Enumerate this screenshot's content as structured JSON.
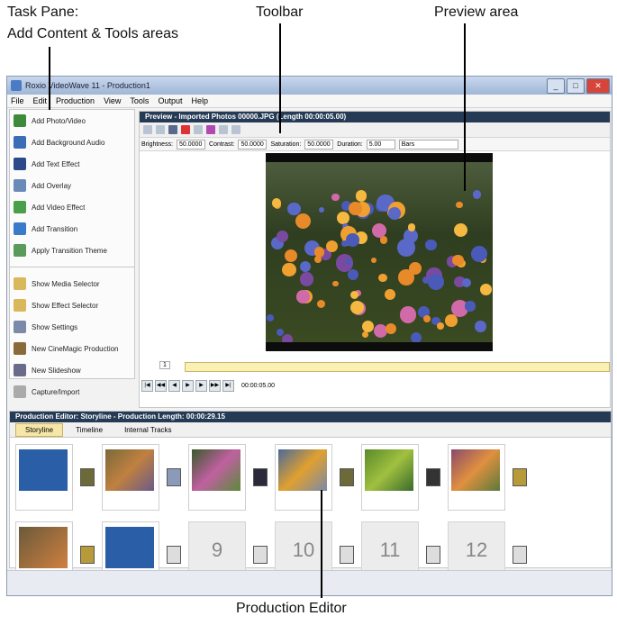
{
  "annotations": {
    "task_pane": "Task Pane:",
    "task_pane_sub": "Add Content & Tools areas",
    "toolbar": "Toolbar",
    "preview_area": "Preview area",
    "production_editor": "Production Editor"
  },
  "window": {
    "title": "Roxio VideoWave 11 - Production1",
    "menu": [
      "File",
      "Edit",
      "Production",
      "View",
      "Tools",
      "Output",
      "Help"
    ]
  },
  "task_pane": {
    "add_items": [
      {
        "label": "Add Photo/Video",
        "icon": "photo-video-icon",
        "color": "#3f8a3a"
      },
      {
        "label": "Add Background Audio",
        "icon": "audio-icon",
        "color": "#3a6fb8"
      },
      {
        "label": "Add Text Effect",
        "icon": "text-effect-icon",
        "color": "#2a4a8a"
      },
      {
        "label": "Add Overlay",
        "icon": "overlay-icon",
        "color": "#6a8ab8"
      },
      {
        "label": "Add Video Effect",
        "icon": "video-effect-icon",
        "color": "#4aa04a"
      },
      {
        "label": "Add Transition",
        "icon": "transition-icon",
        "color": "#3a7ac8"
      },
      {
        "label": "Apply Transition Theme",
        "icon": "transition-theme-icon",
        "color": "#5a9a5a"
      }
    ],
    "tool_items": [
      {
        "label": "Show Media Selector",
        "icon": "media-selector-icon",
        "color": "#d8b85a"
      },
      {
        "label": "Show Effect Selector",
        "icon": "effect-selector-icon",
        "color": "#d8b85a"
      },
      {
        "label": "Show Settings",
        "icon": "settings-icon",
        "color": "#7a8aa8"
      },
      {
        "label": "New CineMagic Production",
        "icon": "cinemagic-icon",
        "color": "#8a6a3a"
      },
      {
        "label": "New Slideshow",
        "icon": "slideshow-icon",
        "color": "#6a6a8a"
      },
      {
        "label": "Capture/Import",
        "icon": "capture-icon",
        "color": "#aaaaaa"
      }
    ]
  },
  "preview": {
    "header": "Preview - Imported Photos 00000.JPG (Length 00:00:05.00)",
    "brightness_label": "Brightness:",
    "brightness_value": "50.0000",
    "contrast_label": "Contrast:",
    "contrast_value": "50.0000",
    "saturation_label": "Saturation:",
    "saturation_value": "50.0000",
    "duration_label": "Duration:",
    "duration_value": "5.00",
    "style_value": "Bars",
    "frame_value": "1",
    "timecode": "00:00:05.00"
  },
  "production_editor": {
    "header": "Production Editor: Storyline - Production Length: 00:00:29.15",
    "tabs": [
      "Storyline",
      "Timeline",
      "Internal Tracks"
    ],
    "row2_numbers": [
      "9",
      "10",
      "11",
      "12"
    ]
  }
}
